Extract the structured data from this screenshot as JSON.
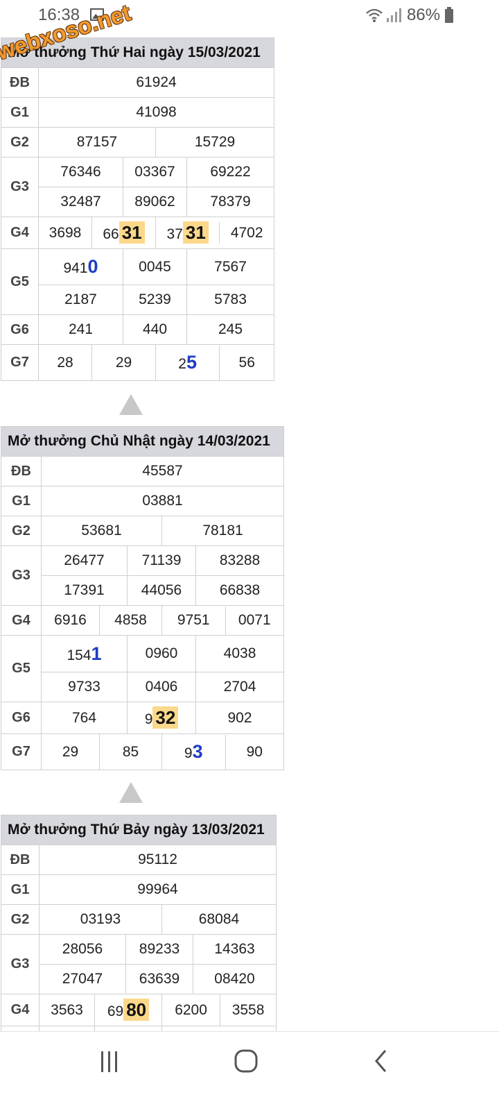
{
  "status": {
    "time": "16:38",
    "battery": "86%"
  },
  "watermark": "webxoso.net",
  "sections": [
    {
      "title": "Mở thưởng Thứ Hai ngày 15/03/2021",
      "db_label": "ĐB",
      "db": "61924",
      "g1_label": "G1",
      "g1": "41098",
      "g2_label": "G2",
      "g2": [
        "87157",
        "15729"
      ],
      "g3_label": "G3",
      "g3": [
        "76346",
        "03367",
        "69222",
        "32487",
        "89062",
        "78379"
      ],
      "g4_label": "G4",
      "g4": [
        {
          "pre": "3698",
          "hl": ""
        },
        {
          "pre": "66",
          "hl": "31"
        },
        {
          "pre": "37",
          "hl": "31"
        },
        {
          "pre": "4702",
          "hl": ""
        }
      ],
      "g5_label": "G5",
      "g5": [
        {
          "pre": "941",
          "blue": "0"
        },
        {
          "pre": "0045",
          "blue": ""
        },
        {
          "pre": "7567",
          "blue": ""
        },
        {
          "pre": "2187",
          "blue": ""
        },
        {
          "pre": "5239",
          "blue": ""
        },
        {
          "pre": "5783",
          "blue": ""
        }
      ],
      "g6_label": "G6",
      "g6": [
        {
          "pre": "241",
          "hl": ""
        },
        {
          "pre": "440",
          "hl": ""
        },
        {
          "pre": "245",
          "hl": ""
        }
      ],
      "g7_label": "G7",
      "g7": [
        {
          "pre": "28",
          "blue": ""
        },
        {
          "pre": "29",
          "blue": ""
        },
        {
          "pre": "2",
          "blue": "5"
        },
        {
          "pre": "56",
          "blue": ""
        }
      ]
    },
    {
      "title": "Mở thưởng Chủ Nhật ngày 14/03/2021",
      "db_label": "ĐB",
      "db": "45587",
      "g1_label": "G1",
      "g1": "03881",
      "g2_label": "G2",
      "g2": [
        "53681",
        "78181"
      ],
      "g3_label": "G3",
      "g3": [
        "26477",
        "71139",
        "83288",
        "17391",
        "44056",
        "66838"
      ],
      "g4_label": "G4",
      "g4": [
        {
          "pre": "6916",
          "hl": ""
        },
        {
          "pre": "4858",
          "hl": ""
        },
        {
          "pre": "9751",
          "hl": ""
        },
        {
          "pre": "0071",
          "hl": ""
        }
      ],
      "g5_label": "G5",
      "g5": [
        {
          "pre": "154",
          "blue": "1"
        },
        {
          "pre": "0960",
          "blue": ""
        },
        {
          "pre": "4038",
          "blue": ""
        },
        {
          "pre": "9733",
          "blue": ""
        },
        {
          "pre": "0406",
          "blue": ""
        },
        {
          "pre": "2704",
          "blue": ""
        }
      ],
      "g6_label": "G6",
      "g6": [
        {
          "pre": "764",
          "hl": ""
        },
        {
          "pre": "9",
          "hl": "32"
        },
        {
          "pre": "902",
          "hl": ""
        }
      ],
      "g7_label": "G7",
      "g7": [
        {
          "pre": "29",
          "blue": ""
        },
        {
          "pre": "85",
          "blue": ""
        },
        {
          "pre": "9",
          "blue": "3"
        },
        {
          "pre": "90",
          "blue": ""
        }
      ]
    },
    {
      "title": "Mở thưởng Thứ Bảy ngày 13/03/2021",
      "db_label": "ĐB",
      "db": "95112",
      "g1_label": "G1",
      "g1": "99964",
      "g2_label": "G2",
      "g2": [
        "03193",
        "68084"
      ],
      "g3_label": "G3",
      "g3": [
        "28056",
        "89233",
        "14363",
        "27047",
        "63639",
        "08420"
      ],
      "g4_label": "G4",
      "g4": [
        {
          "pre": "3563",
          "hl": ""
        },
        {
          "pre": "69",
          "hl": "80"
        },
        {
          "pre": "6200",
          "hl": ""
        },
        {
          "pre": "3558",
          "hl": ""
        }
      ]
    }
  ]
}
